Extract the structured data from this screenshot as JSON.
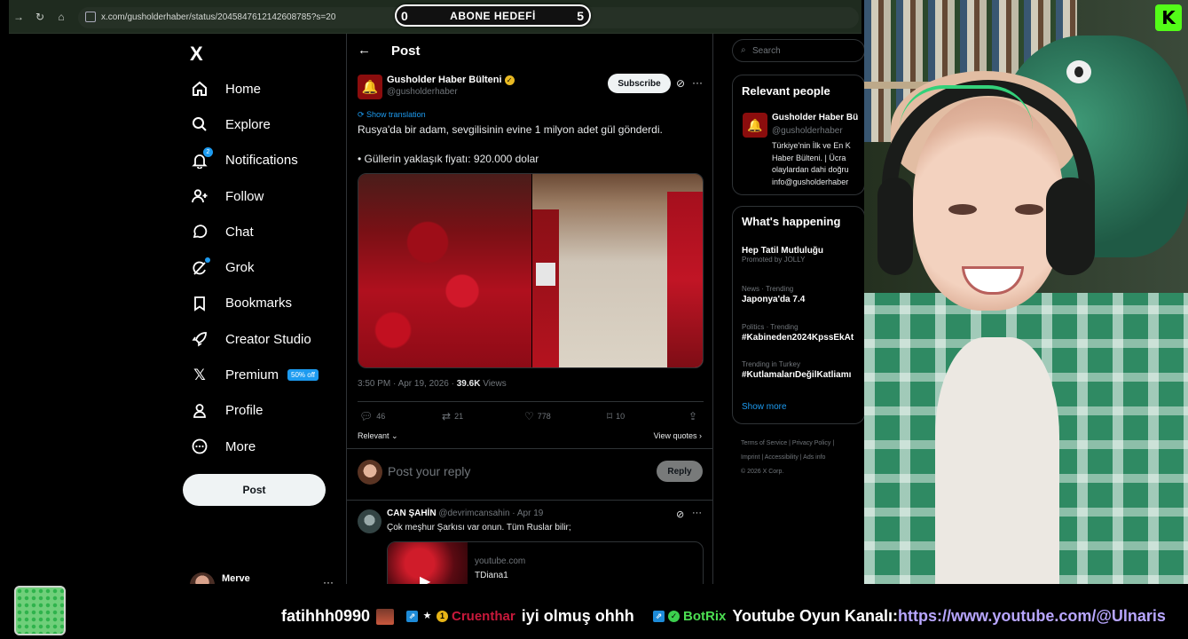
{
  "browser": {
    "url": "x.com/gusholderhaber/status/2045847612142608785?s=20"
  },
  "goal_overlay": {
    "left_value": "0",
    "title": "ABONE HEDEFİ",
    "right_value": "5"
  },
  "sidebar": {
    "logo": "X",
    "items": [
      {
        "label": "Home",
        "icon": "home-icon"
      },
      {
        "label": "Explore",
        "icon": "search-icon"
      },
      {
        "label": "Notifications",
        "icon": "bell-icon",
        "badge": "2"
      },
      {
        "label": "Follow",
        "icon": "person-plus-icon"
      },
      {
        "label": "Chat",
        "icon": "chat-bubble-icon"
      },
      {
        "label": "Grok",
        "icon": "grok-icon"
      },
      {
        "label": "Bookmarks",
        "icon": "bookmark-icon"
      },
      {
        "label": "Creator Studio",
        "icon": "rocket-icon"
      },
      {
        "label": "Premium",
        "icon": "x-icon",
        "promo": "50% off"
      },
      {
        "label": "Profile",
        "icon": "person-icon"
      },
      {
        "label": "More",
        "icon": "more-circle-icon"
      }
    ],
    "post_button": "Post",
    "account_name": "Merve",
    "account_more": "···"
  },
  "post": {
    "header_title": "Post",
    "author_name": "Gusholder Haber Bülteni",
    "author_handle": "@gusholderhaber",
    "subscribe_label": "Subscribe",
    "show_translation": "Show translation",
    "text_line1": "Rusya'da bir adam, sevgilisinin evine 1 milyon adet gül gönderdi.",
    "text_line2": "• Güllerin yaklaşık fiyatı: 920.000 dolar",
    "meta_time": "3:50 PM · Apr 19, 2026 · ",
    "meta_views_count": "39.6K",
    "meta_views_label": " Views",
    "stats": {
      "replies": "46",
      "reposts": "21",
      "likes": "778",
      "bookmarks": "10"
    },
    "relevant_label": "Relevant",
    "view_quotes_label": "View quotes",
    "reply_placeholder": "Post your reply",
    "reply_button": "Reply"
  },
  "comment": {
    "name": "CAN ŞAHİN",
    "handle_date": " @devrimcansahin · Apr 19",
    "text": "Çok meşhur Şarkısı var onun. Tüm Ruslar bilir;",
    "card_domain": "youtube.com",
    "card_title": "TDiana1"
  },
  "right_col": {
    "search_placeholder": "Search",
    "relevant_people_title": "Relevant people",
    "rp_name": "Gusholder Haber Bü",
    "rp_handle": "@gusholderhaber",
    "rp_bio": "Türkiye'nin İlk ve En K\nHaber Bülteni. | Ücra \nolaylardan dahi doğru\ninfo@gusholderhaber",
    "whats_happening_title": "What's happening",
    "trends": [
      {
        "category": "",
        "name": "Hep Tatil Mutluluğu",
        "sub": "Promoted by JOLLY"
      },
      {
        "category": "News · Trending",
        "name": "Japonya'da 7.4"
      },
      {
        "category": "Politics · Trending",
        "name": "#Kabineden2024KpssEkAt"
      },
      {
        "category": "Trending in Turkey",
        "name": "#KutlamalarıDeğilKatliamı"
      }
    ],
    "show_more": "Show more",
    "footer_line1": "Terms of Service  |  Privacy Policy  |",
    "footer_line2": "Imprint  |  Accessibility  |  Ads info",
    "footer_line3": "© 2026 X Corp."
  },
  "stream": {
    "kick_logo": "K"
  },
  "chat": [
    {
      "user": "fatihhh0990",
      "text": ""
    },
    {
      "user": "Cruenthar",
      "text": "iyi olmuş ohhh"
    },
    {
      "user": "BotRix",
      "text": "Youtube Oyun Kanalı: ",
      "link": "https://www.youtube.com/@Ulnaris"
    }
  ],
  "colors": {
    "accent": "#1d9bf0",
    "kick_green": "#53fc18",
    "background": "#000000"
  }
}
